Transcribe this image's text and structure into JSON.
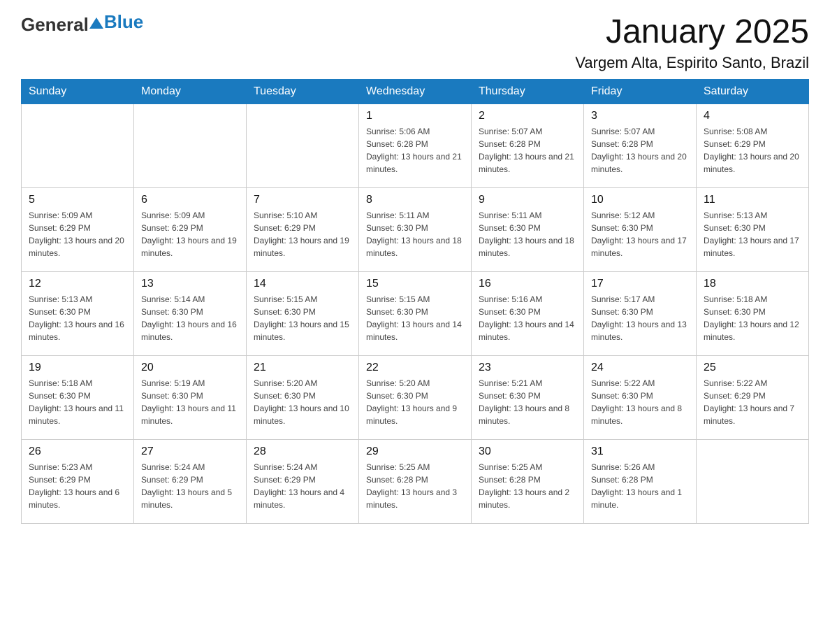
{
  "header": {
    "logo_general": "General",
    "logo_blue": "Blue",
    "title": "January 2025",
    "subtitle": "Vargem Alta, Espirito Santo, Brazil"
  },
  "weekdays": [
    "Sunday",
    "Monday",
    "Tuesday",
    "Wednesday",
    "Thursday",
    "Friday",
    "Saturday"
  ],
  "weeks": [
    [
      {
        "day": "",
        "info": ""
      },
      {
        "day": "",
        "info": ""
      },
      {
        "day": "",
        "info": ""
      },
      {
        "day": "1",
        "info": "Sunrise: 5:06 AM\nSunset: 6:28 PM\nDaylight: 13 hours and 21 minutes."
      },
      {
        "day": "2",
        "info": "Sunrise: 5:07 AM\nSunset: 6:28 PM\nDaylight: 13 hours and 21 minutes."
      },
      {
        "day": "3",
        "info": "Sunrise: 5:07 AM\nSunset: 6:28 PM\nDaylight: 13 hours and 20 minutes."
      },
      {
        "day": "4",
        "info": "Sunrise: 5:08 AM\nSunset: 6:29 PM\nDaylight: 13 hours and 20 minutes."
      }
    ],
    [
      {
        "day": "5",
        "info": "Sunrise: 5:09 AM\nSunset: 6:29 PM\nDaylight: 13 hours and 20 minutes."
      },
      {
        "day": "6",
        "info": "Sunrise: 5:09 AM\nSunset: 6:29 PM\nDaylight: 13 hours and 19 minutes."
      },
      {
        "day": "7",
        "info": "Sunrise: 5:10 AM\nSunset: 6:29 PM\nDaylight: 13 hours and 19 minutes."
      },
      {
        "day": "8",
        "info": "Sunrise: 5:11 AM\nSunset: 6:30 PM\nDaylight: 13 hours and 18 minutes."
      },
      {
        "day": "9",
        "info": "Sunrise: 5:11 AM\nSunset: 6:30 PM\nDaylight: 13 hours and 18 minutes."
      },
      {
        "day": "10",
        "info": "Sunrise: 5:12 AM\nSunset: 6:30 PM\nDaylight: 13 hours and 17 minutes."
      },
      {
        "day": "11",
        "info": "Sunrise: 5:13 AM\nSunset: 6:30 PM\nDaylight: 13 hours and 17 minutes."
      }
    ],
    [
      {
        "day": "12",
        "info": "Sunrise: 5:13 AM\nSunset: 6:30 PM\nDaylight: 13 hours and 16 minutes."
      },
      {
        "day": "13",
        "info": "Sunrise: 5:14 AM\nSunset: 6:30 PM\nDaylight: 13 hours and 16 minutes."
      },
      {
        "day": "14",
        "info": "Sunrise: 5:15 AM\nSunset: 6:30 PM\nDaylight: 13 hours and 15 minutes."
      },
      {
        "day": "15",
        "info": "Sunrise: 5:15 AM\nSunset: 6:30 PM\nDaylight: 13 hours and 14 minutes."
      },
      {
        "day": "16",
        "info": "Sunrise: 5:16 AM\nSunset: 6:30 PM\nDaylight: 13 hours and 14 minutes."
      },
      {
        "day": "17",
        "info": "Sunrise: 5:17 AM\nSunset: 6:30 PM\nDaylight: 13 hours and 13 minutes."
      },
      {
        "day": "18",
        "info": "Sunrise: 5:18 AM\nSunset: 6:30 PM\nDaylight: 13 hours and 12 minutes."
      }
    ],
    [
      {
        "day": "19",
        "info": "Sunrise: 5:18 AM\nSunset: 6:30 PM\nDaylight: 13 hours and 11 minutes."
      },
      {
        "day": "20",
        "info": "Sunrise: 5:19 AM\nSunset: 6:30 PM\nDaylight: 13 hours and 11 minutes."
      },
      {
        "day": "21",
        "info": "Sunrise: 5:20 AM\nSunset: 6:30 PM\nDaylight: 13 hours and 10 minutes."
      },
      {
        "day": "22",
        "info": "Sunrise: 5:20 AM\nSunset: 6:30 PM\nDaylight: 13 hours and 9 minutes."
      },
      {
        "day": "23",
        "info": "Sunrise: 5:21 AM\nSunset: 6:30 PM\nDaylight: 13 hours and 8 minutes."
      },
      {
        "day": "24",
        "info": "Sunrise: 5:22 AM\nSunset: 6:30 PM\nDaylight: 13 hours and 8 minutes."
      },
      {
        "day": "25",
        "info": "Sunrise: 5:22 AM\nSunset: 6:29 PM\nDaylight: 13 hours and 7 minutes."
      }
    ],
    [
      {
        "day": "26",
        "info": "Sunrise: 5:23 AM\nSunset: 6:29 PM\nDaylight: 13 hours and 6 minutes."
      },
      {
        "day": "27",
        "info": "Sunrise: 5:24 AM\nSunset: 6:29 PM\nDaylight: 13 hours and 5 minutes."
      },
      {
        "day": "28",
        "info": "Sunrise: 5:24 AM\nSunset: 6:29 PM\nDaylight: 13 hours and 4 minutes."
      },
      {
        "day": "29",
        "info": "Sunrise: 5:25 AM\nSunset: 6:28 PM\nDaylight: 13 hours and 3 minutes."
      },
      {
        "day": "30",
        "info": "Sunrise: 5:25 AM\nSunset: 6:28 PM\nDaylight: 13 hours and 2 minutes."
      },
      {
        "day": "31",
        "info": "Sunrise: 5:26 AM\nSunset: 6:28 PM\nDaylight: 13 hours and 1 minute."
      },
      {
        "day": "",
        "info": ""
      }
    ]
  ]
}
